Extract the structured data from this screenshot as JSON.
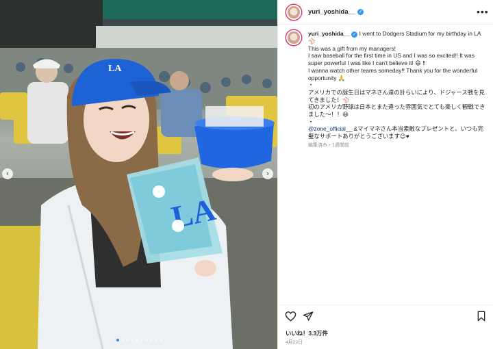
{
  "colors": {
    "accent": "#3897f0",
    "link": "#00376b",
    "muted": "#8e8e8e",
    "dodger_blue": "#1f5fd8"
  },
  "photo": {
    "carousel_prev": "‹",
    "carousel_next": "›",
    "logo_text": "LA"
  },
  "header": {
    "username": "yuri_yoshida__",
    "verified_mark": "✓",
    "more": "•••"
  },
  "caption": {
    "username": "yuri_yoshida__",
    "verified_mark": "✓",
    "line1": "I went to Dodgers Stadium for my birthday in LA⚾",
    "line2": "This was a gift from my managers!",
    "line3": "I saw baseball for the first time in US and I was so excited!! It was super powerful I was like I can't believe it! 😄 ‼",
    "line4": "I wanna watch other teams someday!! Thank you for the wonderful opportunity 🙏",
    "bullet1": "・",
    "line5": "アメリカでの誕生日はマネさん達の計らいにより、ドジャース戦を見てきました！⚾",
    "line6": "初のアメリカ野球は日本とまた違った雰囲気でとても楽しく観戦できました〜！！😄",
    "bullet2": "・",
    "mention": "@zone_official__",
    "line7": " &マイマネさん本当素敵なプレゼントと、いつも完璧なサポートありがとうございます😉♥",
    "meta": "編集済み・1週間前"
  },
  "actions": {
    "likes": "いいね！3.3万件",
    "date": "4月22日"
  }
}
